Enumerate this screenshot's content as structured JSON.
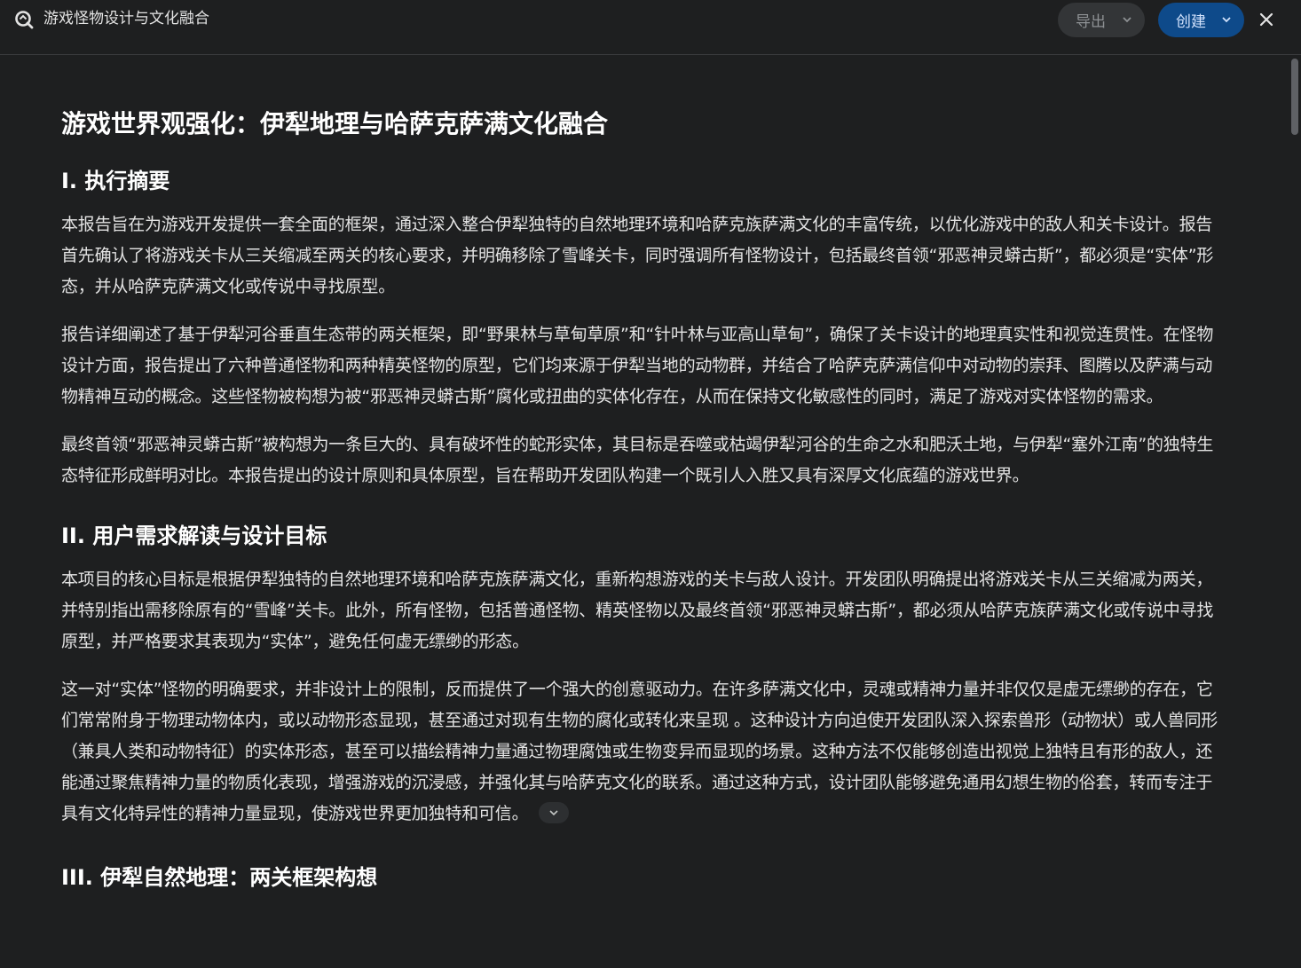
{
  "header": {
    "doc_title": "游戏怪物设计与文化融合",
    "export_label": "导出",
    "create_label": "创建"
  },
  "colors": {
    "background": "#1e1f20",
    "create_button": "#0e4a8a",
    "export_button": "#333537"
  },
  "document": {
    "title": "游戏世界观强化：伊犁地理与哈萨克萨满文化融合",
    "sections": [
      {
        "heading": "I. 执行摘要",
        "paragraphs": [
          "本报告旨在为游戏开发提供一套全面的框架，通过深入整合伊犁独特的自然地理环境和哈萨克族萨满文化的丰富传统，以优化游戏中的敌人和关卡设计。报告首先确认了将游戏关卡从三关缩减至两关的核心要求，并明确移除了雪峰关卡，同时强调所有怪物设计，包括最终首领“邪恶神灵蟒古斯”，都必须是“实体”形态，并从哈萨克萨满文化或传说中寻找原型。",
          "报告详细阐述了基于伊犁河谷垂直生态带的两关框架，即“野果林与草甸草原”和“针叶林与亚高山草甸”，确保了关卡设计的地理真实性和视觉连贯性。在怪物设计方面，报告提出了六种普通怪物和两种精英怪物的原型，它们均来源于伊犁当地的动物群，并结合了哈萨克萨满信仰中对动物的崇拜、图腾以及萨满与动物精神互动的概念。这些怪物被构想为被“邪恶神灵蟒古斯”腐化或扭曲的实体化存在，从而在保持文化敏感性的同时，满足了游戏对实体怪物的需求。",
          "最终首领“邪恶神灵蟒古斯”被构想为一条巨大的、具有破坏性的蛇形实体，其目标是吞噬或枯竭伊犁河谷的生命之水和肥沃土地，与伊犁“塞外江南”的独特生态特征形成鲜明对比。本报告提出的设计原则和具体原型，旨在帮助开发团队构建一个既引人入胜又具有深厚文化底蕴的游戏世界。"
        ]
      },
      {
        "heading": "II. 用户需求解读与设计目标",
        "paragraphs": [
          "本项目的核心目标是根据伊犁独特的自然地理环境和哈萨克族萨满文化，重新构想游戏的关卡与敌人设计。开发团队明确提出将游戏关卡从三关缩减为两关，并特别指出需移除原有的“雪峰”关卡。此外，所有怪物，包括普通怪物、精英怪物以及最终首领“邪恶神灵蟒古斯”，都必须从哈萨克族萨满文化或传说中寻找原型，并严格要求其表现为“实体”，避免任何虚无缥缈的形态。",
          "这一对“实体”怪物的明确要求，并非设计上的限制，反而提供了一个强大的创意驱动力。在许多萨满文化中，灵魂或精神力量并非仅仅是虚无缥缈的存在，它们常常附身于物理动物体内，或以动物形态显现，甚至通过对现有生物的腐化或转化来呈现 。这种设计方向迫使开发团队深入探索兽形（动物状）或人兽同形（兼具人类和动物特征）的实体形态，甚至可以描绘精神力量通过物理腐蚀或生物变异而显现的场景。这种方法不仅能够创造出视觉上独特且有形的敌人，还能通过聚焦精神力量的物质化表现，增强游戏的沉浸感，并强化其与哈萨克文化的联系。通过这种方式，设计团队能够避免通用幻想生物的俗套，转而专注于具有文化特异性的精神力量显现，使游戏世界更加独特和可信。"
        ]
      },
      {
        "heading": "III. 伊犁自然地理：两关框架构想"
      }
    ]
  }
}
